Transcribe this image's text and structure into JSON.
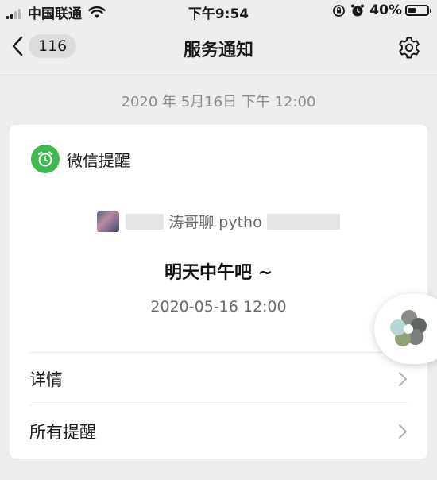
{
  "status_bar": {
    "carrier": "中国联通",
    "time": "下午9:54",
    "battery": "40%",
    "battery_level": 0.4
  },
  "nav": {
    "back_count": "116",
    "title": "服务通知"
  },
  "timestamp": "2020 年 5月16日 下午 12:00",
  "card": {
    "app_name": "微信提醒",
    "sender": "涛哥聊 pytho",
    "message": "明天中午吧 ~",
    "time": "2020-05-16 12:00",
    "rows": [
      {
        "label": "详情"
      },
      {
        "label": "所有提醒"
      }
    ]
  },
  "colors": {
    "background": "#ededed",
    "card": "#ffffff",
    "accent": "#3fb950"
  }
}
